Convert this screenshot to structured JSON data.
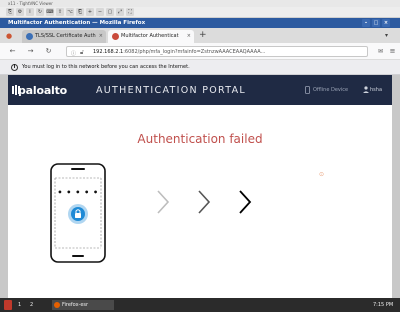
{
  "vnc": {
    "title": "x11 - TightVNC Viewer"
  },
  "window": {
    "title": "Multifactor Authentication — Mozilla Firefox"
  },
  "tabs": [
    {
      "label": "TLS/SSL Certificate Auth"
    },
    {
      "label": "Multifactor Authenticat"
    }
  ],
  "new_tab": "+",
  "urlbar": {
    "host": "192.168.2.1",
    "rest": ":6082/php/mfa_login?mfainfo=ZstnzwAAACEAAQAAAA..."
  },
  "notification": {
    "text": "You must log in to this network before you can access the Internet."
  },
  "header": {
    "brand": "paloalto",
    "portal_title": "AUTHENTICATION PORTAL",
    "device_status": "Offline Device",
    "username": "hsha"
  },
  "main": {
    "status_title": "Authentication failed",
    "pin_dots": "• • • • •"
  },
  "taskbar": {
    "workspace_1": "1",
    "workspace_2": "2",
    "task_label": "Firefox-esr",
    "clock": "7:15 PM"
  },
  "colors": {
    "error_red": "#c0504d",
    "header_navy": "#1f2a44",
    "lock_blue": "#1e8ad6"
  }
}
